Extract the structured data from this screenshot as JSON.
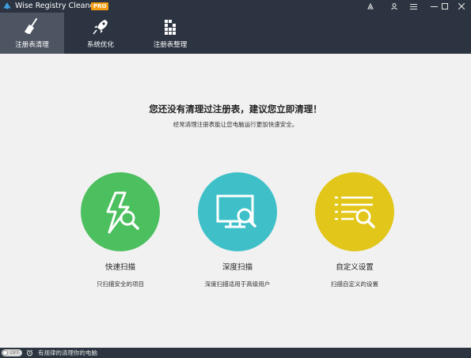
{
  "window": {
    "title": "Wise Registry Cleaner X",
    "badge": "PRO",
    "colors": {
      "chrome": "#2b3440",
      "active_tab": "#4c5561",
      "background": "#f1f1f1",
      "badge": "#f39c12"
    },
    "controls": [
      "theme-icon",
      "user-icon",
      "menu-icon",
      "minimize-icon",
      "maximize-icon",
      "close-icon"
    ]
  },
  "toolbar": {
    "tabs": [
      {
        "label": "注册表清理",
        "icon": "broom-icon",
        "active": true
      },
      {
        "label": "系统优化",
        "icon": "rocket-icon",
        "active": false
      },
      {
        "label": "注册表整理",
        "icon": "defrag-blocks-icon",
        "active": false
      }
    ]
  },
  "main": {
    "headline": "您还没有清理过注册表，建议您立即清理！",
    "subline": "经常清理注册表能让您电脑运行更加快速安全。",
    "options": [
      {
        "title": "快速扫描",
        "desc": "只扫描安全的项目",
        "color": "#4cbf5e",
        "icon": "lightning-search-icon"
      },
      {
        "title": "深度扫描",
        "desc": "深度扫描适用于高级用户",
        "color": "#3fc0c9",
        "icon": "monitor-search-icon"
      },
      {
        "title": "自定义设置",
        "desc": "扫描自定义的设置",
        "color": "#e2c619",
        "icon": "list-search-icon"
      }
    ]
  },
  "status": {
    "toggle_label": "OFF",
    "toggle_on": false,
    "text": "有规律的清理你的电脑",
    "icon": "alarm-clock-icon"
  }
}
